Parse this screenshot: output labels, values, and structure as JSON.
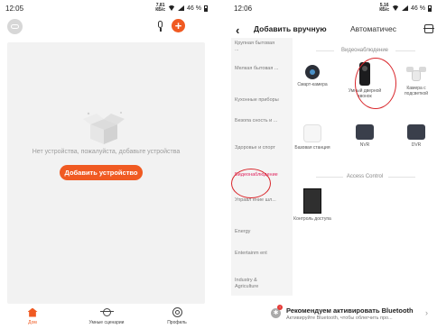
{
  "left_screen": {
    "status_bar": {
      "time": "12:05",
      "speed": "7,81\nКБ/с",
      "battery": "46 %"
    },
    "empty_state": {
      "message": "Нет устройства, пожалуйста, добавьте устройства",
      "add_button": "Добавить устройство"
    },
    "tabs": [
      {
        "label": "Дом",
        "icon": "home-icon",
        "active": true
      },
      {
        "label": "Умные сценарии",
        "icon": "smart-scene-icon",
        "active": false
      },
      {
        "label": "Профиль",
        "icon": "profile-icon",
        "active": false
      }
    ],
    "accent_color": "#f05a22"
  },
  "right_screen": {
    "status_bar": {
      "time": "12:06",
      "speed": "5,16\nКБ/с",
      "battery": "46 %"
    },
    "header": {
      "title": "Добавить вручную",
      "tab2": "Автоматичес"
    },
    "categories": [
      "Крупная бытовая ...",
      "Мелкая бытовая ...",
      "Кухонные приборы",
      "Безопа сность и ...",
      "Здоровье и спорт",
      "Видеонаблюдение",
      "Управл ение шл...",
      "Energy",
      "Entertainm ent",
      "Industry & Agriculture"
    ],
    "sections": [
      {
        "title": "Видеонаблюдение",
        "devices": [
          {
            "label": "Смарт-камера",
            "icon": "smart-camera-icon"
          },
          {
            "label": "Умный дверной звонок",
            "icon": "doorbell-icon"
          },
          {
            "label": "Камера с подсветкой",
            "icon": "floodlight-camera-icon"
          },
          {
            "label": "Базовая станция",
            "icon": "base-station-icon"
          },
          {
            "label": "NVR",
            "icon": "nvr-icon"
          },
          {
            "label": "DVR",
            "icon": "dvr-icon"
          }
        ]
      },
      {
        "title": "Access Control",
        "devices": [
          {
            "label": "Контроль доступа",
            "icon": "access-control-icon"
          }
        ]
      }
    ],
    "bluetooth_banner": {
      "title": "Рекомендуем активировать Bluetooth",
      "subtitle": "Активируйте Bluetooth, чтобы облегчить про...",
      "badge": "!"
    },
    "highlight_color": "#d9262b"
  }
}
